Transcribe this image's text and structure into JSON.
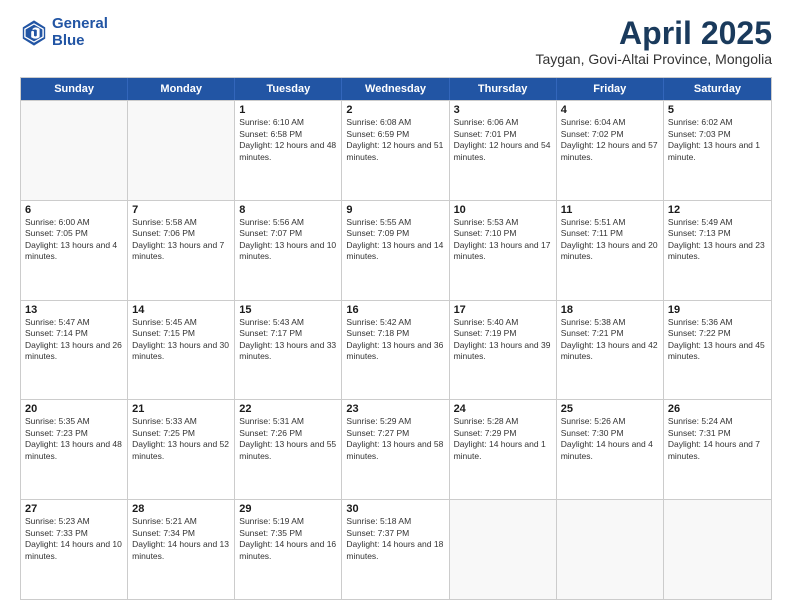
{
  "header": {
    "logo_line1": "General",
    "logo_line2": "Blue",
    "month_year": "April 2025",
    "location": "Taygan, Govi-Altai Province, Mongolia"
  },
  "days_of_week": [
    "Sunday",
    "Monday",
    "Tuesday",
    "Wednesday",
    "Thursday",
    "Friday",
    "Saturday"
  ],
  "weeks": [
    [
      {
        "day": "",
        "sunrise": "",
        "sunset": "",
        "daylight": ""
      },
      {
        "day": "",
        "sunrise": "",
        "sunset": "",
        "daylight": ""
      },
      {
        "day": "1",
        "sunrise": "Sunrise: 6:10 AM",
        "sunset": "Sunset: 6:58 PM",
        "daylight": "Daylight: 12 hours and 48 minutes."
      },
      {
        "day": "2",
        "sunrise": "Sunrise: 6:08 AM",
        "sunset": "Sunset: 6:59 PM",
        "daylight": "Daylight: 12 hours and 51 minutes."
      },
      {
        "day": "3",
        "sunrise": "Sunrise: 6:06 AM",
        "sunset": "Sunset: 7:01 PM",
        "daylight": "Daylight: 12 hours and 54 minutes."
      },
      {
        "day": "4",
        "sunrise": "Sunrise: 6:04 AM",
        "sunset": "Sunset: 7:02 PM",
        "daylight": "Daylight: 12 hours and 57 minutes."
      },
      {
        "day": "5",
        "sunrise": "Sunrise: 6:02 AM",
        "sunset": "Sunset: 7:03 PM",
        "daylight": "Daylight: 13 hours and 1 minute."
      }
    ],
    [
      {
        "day": "6",
        "sunrise": "Sunrise: 6:00 AM",
        "sunset": "Sunset: 7:05 PM",
        "daylight": "Daylight: 13 hours and 4 minutes."
      },
      {
        "day": "7",
        "sunrise": "Sunrise: 5:58 AM",
        "sunset": "Sunset: 7:06 PM",
        "daylight": "Daylight: 13 hours and 7 minutes."
      },
      {
        "day": "8",
        "sunrise": "Sunrise: 5:56 AM",
        "sunset": "Sunset: 7:07 PM",
        "daylight": "Daylight: 13 hours and 10 minutes."
      },
      {
        "day": "9",
        "sunrise": "Sunrise: 5:55 AM",
        "sunset": "Sunset: 7:09 PM",
        "daylight": "Daylight: 13 hours and 14 minutes."
      },
      {
        "day": "10",
        "sunrise": "Sunrise: 5:53 AM",
        "sunset": "Sunset: 7:10 PM",
        "daylight": "Daylight: 13 hours and 17 minutes."
      },
      {
        "day": "11",
        "sunrise": "Sunrise: 5:51 AM",
        "sunset": "Sunset: 7:11 PM",
        "daylight": "Daylight: 13 hours and 20 minutes."
      },
      {
        "day": "12",
        "sunrise": "Sunrise: 5:49 AM",
        "sunset": "Sunset: 7:13 PM",
        "daylight": "Daylight: 13 hours and 23 minutes."
      }
    ],
    [
      {
        "day": "13",
        "sunrise": "Sunrise: 5:47 AM",
        "sunset": "Sunset: 7:14 PM",
        "daylight": "Daylight: 13 hours and 26 minutes."
      },
      {
        "day": "14",
        "sunrise": "Sunrise: 5:45 AM",
        "sunset": "Sunset: 7:15 PM",
        "daylight": "Daylight: 13 hours and 30 minutes."
      },
      {
        "day": "15",
        "sunrise": "Sunrise: 5:43 AM",
        "sunset": "Sunset: 7:17 PM",
        "daylight": "Daylight: 13 hours and 33 minutes."
      },
      {
        "day": "16",
        "sunrise": "Sunrise: 5:42 AM",
        "sunset": "Sunset: 7:18 PM",
        "daylight": "Daylight: 13 hours and 36 minutes."
      },
      {
        "day": "17",
        "sunrise": "Sunrise: 5:40 AM",
        "sunset": "Sunset: 7:19 PM",
        "daylight": "Daylight: 13 hours and 39 minutes."
      },
      {
        "day": "18",
        "sunrise": "Sunrise: 5:38 AM",
        "sunset": "Sunset: 7:21 PM",
        "daylight": "Daylight: 13 hours and 42 minutes."
      },
      {
        "day": "19",
        "sunrise": "Sunrise: 5:36 AM",
        "sunset": "Sunset: 7:22 PM",
        "daylight": "Daylight: 13 hours and 45 minutes."
      }
    ],
    [
      {
        "day": "20",
        "sunrise": "Sunrise: 5:35 AM",
        "sunset": "Sunset: 7:23 PM",
        "daylight": "Daylight: 13 hours and 48 minutes."
      },
      {
        "day": "21",
        "sunrise": "Sunrise: 5:33 AM",
        "sunset": "Sunset: 7:25 PM",
        "daylight": "Daylight: 13 hours and 52 minutes."
      },
      {
        "day": "22",
        "sunrise": "Sunrise: 5:31 AM",
        "sunset": "Sunset: 7:26 PM",
        "daylight": "Daylight: 13 hours and 55 minutes."
      },
      {
        "day": "23",
        "sunrise": "Sunrise: 5:29 AM",
        "sunset": "Sunset: 7:27 PM",
        "daylight": "Daylight: 13 hours and 58 minutes."
      },
      {
        "day": "24",
        "sunrise": "Sunrise: 5:28 AM",
        "sunset": "Sunset: 7:29 PM",
        "daylight": "Daylight: 14 hours and 1 minute."
      },
      {
        "day": "25",
        "sunrise": "Sunrise: 5:26 AM",
        "sunset": "Sunset: 7:30 PM",
        "daylight": "Daylight: 14 hours and 4 minutes."
      },
      {
        "day": "26",
        "sunrise": "Sunrise: 5:24 AM",
        "sunset": "Sunset: 7:31 PM",
        "daylight": "Daylight: 14 hours and 7 minutes."
      }
    ],
    [
      {
        "day": "27",
        "sunrise": "Sunrise: 5:23 AM",
        "sunset": "Sunset: 7:33 PM",
        "daylight": "Daylight: 14 hours and 10 minutes."
      },
      {
        "day": "28",
        "sunrise": "Sunrise: 5:21 AM",
        "sunset": "Sunset: 7:34 PM",
        "daylight": "Daylight: 14 hours and 13 minutes."
      },
      {
        "day": "29",
        "sunrise": "Sunrise: 5:19 AM",
        "sunset": "Sunset: 7:35 PM",
        "daylight": "Daylight: 14 hours and 16 minutes."
      },
      {
        "day": "30",
        "sunrise": "Sunrise: 5:18 AM",
        "sunset": "Sunset: 7:37 PM",
        "daylight": "Daylight: 14 hours and 18 minutes."
      },
      {
        "day": "",
        "sunrise": "",
        "sunset": "",
        "daylight": ""
      },
      {
        "day": "",
        "sunrise": "",
        "sunset": "",
        "daylight": ""
      },
      {
        "day": "",
        "sunrise": "",
        "sunset": "",
        "daylight": ""
      }
    ]
  ]
}
